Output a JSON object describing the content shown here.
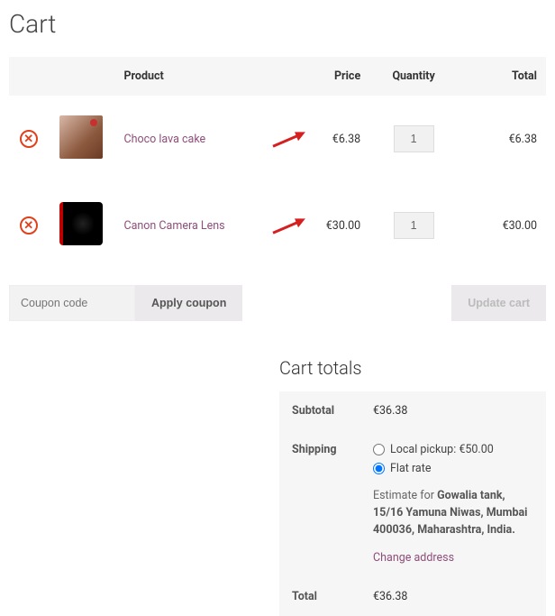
{
  "title": "Cart",
  "headers": {
    "product": "Product",
    "price": "Price",
    "qty": "Quantity",
    "total": "Total"
  },
  "items": [
    {
      "name": "Choco lava cake",
      "price": "€6.38",
      "qty": "1",
      "total": "€6.38",
      "thumb": "cake"
    },
    {
      "name": "Canon Camera Lens",
      "price": "€30.00",
      "qty": "1",
      "total": "€30.00",
      "thumb": "lens"
    }
  ],
  "coupon": {
    "placeholder": "Coupon code",
    "apply": "Apply coupon"
  },
  "update": "Update cart",
  "totals": {
    "heading": "Cart totals",
    "subtotal_label": "Subtotal",
    "subtotal": "€36.38",
    "shipping_label": "Shipping",
    "shipping_options": [
      {
        "label": "Local pickup: €50.00",
        "checked": false
      },
      {
        "label": "Flat rate",
        "checked": true
      }
    ],
    "estimate_prefix": "Estimate for ",
    "estimate_address": "Gowalia tank, 15/16 Yamuna Niwas, Mumbai 400036, Maharashtra, India.",
    "change_address": "Change address",
    "total_label": "Total",
    "total": "€36.38"
  }
}
